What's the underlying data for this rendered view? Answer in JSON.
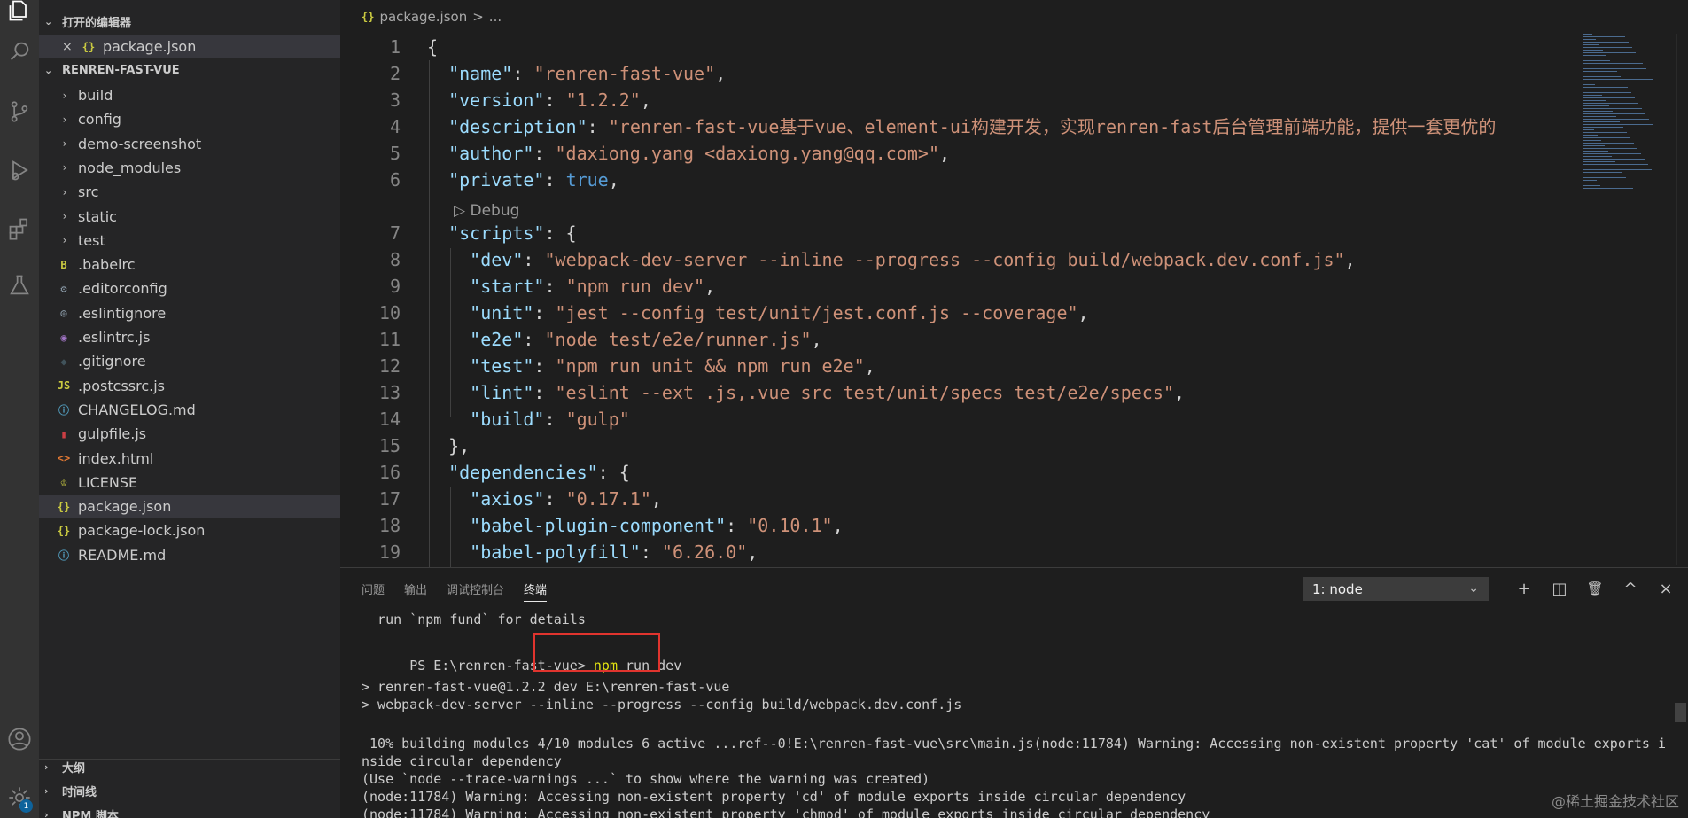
{
  "open_editors": {
    "title": "打开的编辑器",
    "file": "package.json",
    "file_icon": "{}"
  },
  "explorer": {
    "root": "RENREN-FAST-VUE",
    "folders": [
      "build",
      "config",
      "demo-screenshot",
      "node_modules",
      "src",
      "static",
      "test"
    ],
    "files": [
      {
        "name": ".babelrc",
        "icon": "B",
        "color": "#cbcb41"
      },
      {
        "name": ".editorconfig",
        "icon": "⚙",
        "color": "#8b9ba8"
      },
      {
        "name": ".eslintignore",
        "icon": "◎",
        "color": "#8b9ba8"
      },
      {
        "name": ".eslintrc.js",
        "icon": "◉",
        "color": "#a074c4"
      },
      {
        "name": ".gitignore",
        "icon": "◆",
        "color": "#41535b"
      },
      {
        "name": ".postcssrc.js",
        "icon": "JS",
        "color": "#cbcb41"
      },
      {
        "name": "CHANGELOG.md",
        "icon": "ⓘ",
        "color": "#519aba"
      },
      {
        "name": "gulpfile.js",
        "icon": "▮",
        "color": "#cc3e44"
      },
      {
        "name": "index.html",
        "icon": "<>",
        "color": "#e37933"
      },
      {
        "name": "LICENSE",
        "icon": "♔",
        "color": "#cbcb41"
      },
      {
        "name": "package.json",
        "icon": "{}",
        "color": "#cbcb41"
      },
      {
        "name": "package-lock.json",
        "icon": "{}",
        "color": "#cbcb41"
      },
      {
        "name": "README.md",
        "icon": "ⓘ",
        "color": "#519aba"
      }
    ],
    "selected": "package.json"
  },
  "bottom_sections": [
    "大纲",
    "时间线",
    "NPM 脚本"
  ],
  "breadcrumb": {
    "icon": "{}",
    "file": "package.json",
    "sep": ">",
    "more": "..."
  },
  "codelens": "▷ Debug",
  "code": [
    {
      "n": "1",
      "t": [
        [
          "p",
          "{"
        ]
      ]
    },
    {
      "n": "2",
      "t": [
        [
          "p",
          "  "
        ],
        [
          "k",
          "\"name\""
        ],
        [
          "p",
          ": "
        ],
        [
          "s",
          "\"renren-fast-vue\""
        ],
        [
          "p",
          ","
        ]
      ]
    },
    {
      "n": "3",
      "t": [
        [
          "p",
          "  "
        ],
        [
          "k",
          "\"version\""
        ],
        [
          "p",
          ": "
        ],
        [
          "s",
          "\"1.2.2\""
        ],
        [
          "p",
          ","
        ]
      ]
    },
    {
      "n": "4",
      "t": [
        [
          "p",
          "  "
        ],
        [
          "k",
          "\"description\""
        ],
        [
          "p",
          ": "
        ],
        [
          "s",
          "\"renren-fast-vue基于vue、element-ui构建开发，实现renren-fast后台管理前端功能，提供一套更优的"
        ]
      ]
    },
    {
      "n": "5",
      "t": [
        [
          "p",
          "  "
        ],
        [
          "k",
          "\"author\""
        ],
        [
          "p",
          ": "
        ],
        [
          "s",
          "\"daxiong.yang <daxiong.yang@qq.com>\""
        ],
        [
          "p",
          ","
        ]
      ]
    },
    {
      "n": "6",
      "t": [
        [
          "p",
          "  "
        ],
        [
          "k",
          "\"private\""
        ],
        [
          "p",
          ": "
        ],
        [
          "b",
          "true"
        ],
        [
          "p",
          ","
        ]
      ]
    },
    {
      "n": "7",
      "t": [
        [
          "p",
          "  "
        ],
        [
          "k",
          "\"scripts\""
        ],
        [
          "p",
          ": {"
        ]
      ]
    },
    {
      "n": "8",
      "t": [
        [
          "p",
          "    "
        ],
        [
          "k",
          "\"dev\""
        ],
        [
          "p",
          ": "
        ],
        [
          "s",
          "\"webpack-dev-server --inline --progress --config build/webpack.dev.conf.js\""
        ],
        [
          "p",
          ","
        ]
      ]
    },
    {
      "n": "9",
      "t": [
        [
          "p",
          "    "
        ],
        [
          "k",
          "\"start\""
        ],
        [
          "p",
          ": "
        ],
        [
          "s",
          "\"npm run dev\""
        ],
        [
          "p",
          ","
        ]
      ]
    },
    {
      "n": "10",
      "t": [
        [
          "p",
          "    "
        ],
        [
          "k",
          "\"unit\""
        ],
        [
          "p",
          ": "
        ],
        [
          "s",
          "\"jest --config test/unit/jest.conf.js --coverage\""
        ],
        [
          "p",
          ","
        ]
      ]
    },
    {
      "n": "11",
      "t": [
        [
          "p",
          "    "
        ],
        [
          "k",
          "\"e2e\""
        ],
        [
          "p",
          ": "
        ],
        [
          "s",
          "\"node test/e2e/runner.js\""
        ],
        [
          "p",
          ","
        ]
      ]
    },
    {
      "n": "12",
      "t": [
        [
          "p",
          "    "
        ],
        [
          "k",
          "\"test\""
        ],
        [
          "p",
          ": "
        ],
        [
          "s",
          "\"npm run unit && npm run e2e\""
        ],
        [
          "p",
          ","
        ]
      ]
    },
    {
      "n": "13",
      "t": [
        [
          "p",
          "    "
        ],
        [
          "k",
          "\"lint\""
        ],
        [
          "p",
          ": "
        ],
        [
          "s",
          "\"eslint --ext .js,.vue src test/unit/specs test/e2e/specs\""
        ],
        [
          "p",
          ","
        ]
      ]
    },
    {
      "n": "14",
      "t": [
        [
          "p",
          "    "
        ],
        [
          "k",
          "\"build\""
        ],
        [
          "p",
          ": "
        ],
        [
          "s",
          "\"gulp\""
        ]
      ]
    },
    {
      "n": "15",
      "t": [
        [
          "p",
          "  },"
        ]
      ]
    },
    {
      "n": "16",
      "t": [
        [
          "p",
          "  "
        ],
        [
          "k",
          "\"dependencies\""
        ],
        [
          "p",
          ": {"
        ]
      ]
    },
    {
      "n": "17",
      "t": [
        [
          "p",
          "    "
        ],
        [
          "k",
          "\"axios\""
        ],
        [
          "p",
          ": "
        ],
        [
          "s",
          "\"0.17.1\""
        ],
        [
          "p",
          ","
        ]
      ]
    },
    {
      "n": "18",
      "t": [
        [
          "p",
          "    "
        ],
        [
          "k",
          "\"babel-plugin-component\""
        ],
        [
          "p",
          ": "
        ],
        [
          "s",
          "\"0.10.1\""
        ],
        [
          "p",
          ","
        ]
      ]
    },
    {
      "n": "19",
      "t": [
        [
          "p",
          "    "
        ],
        [
          "k",
          "\"babel-polyfill\""
        ],
        [
          "p",
          ": "
        ],
        [
          "s",
          "\"6.26.0\""
        ],
        [
          "p",
          ","
        ]
      ]
    }
  ],
  "panel": {
    "tabs": [
      "问题",
      "输出",
      "调试控制台",
      "终端"
    ],
    "active_tab": "终端",
    "terminal_select": "1: node",
    "actions": [
      "+",
      "◫",
      "🗑",
      "^",
      "×"
    ]
  },
  "terminal": {
    "fund_line": "  run `npm fund` for details",
    "prompt": "PS E:\\renren-fast-vue> ",
    "cmd_npm": "npm",
    "cmd_rest": " run dev",
    "lines": [
      "> renren-fast-vue@1.2.2 dev E:\\renren-fast-vue",
      "> webpack-dev-server --inline --progress --config build/webpack.dev.conf.js",
      "",
      " 10% building modules 4/10 modules 6 active ...ref--0!E:\\renren-fast-vue\\src\\main.js(node:11784) Warning: Accessing non-existent property 'cat' of module exports i",
      "nside circular dependency",
      "(Use `node --trace-warnings ...` to show where the warning was created)",
      "(node:11784) Warning: Accessing non-existent property 'cd' of module exports inside circular dependency",
      "(node:11784) Warning: Accessing non-existent property 'chmod' of module exports inside circular dependency"
    ]
  },
  "activity_badge": "1",
  "watermark": "@稀土掘金技术社区"
}
